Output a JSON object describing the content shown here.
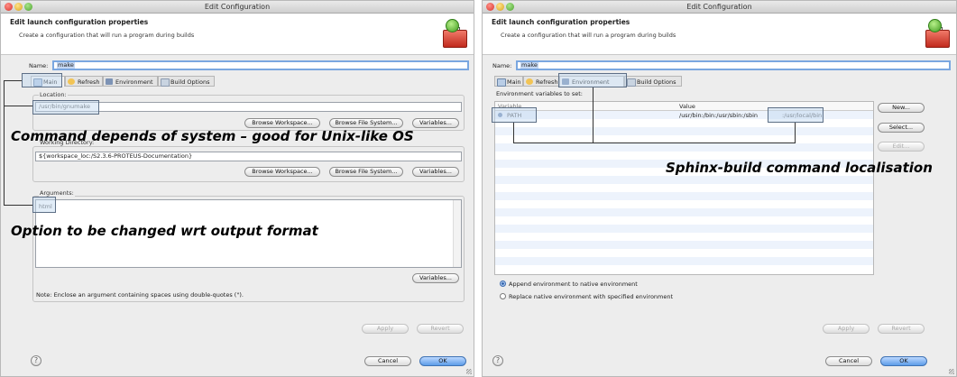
{
  "window_title": "Edit Configuration",
  "banner": {
    "heading": "Edit launch configuration properties",
    "subtitle": "Create a configuration that will run a program during builds"
  },
  "name_label": "Name:",
  "name_value": "make",
  "tabs": [
    {
      "label": "Main",
      "icon": "main-tab-icon"
    },
    {
      "label": "Refresh",
      "icon": "refresh-tab-icon"
    },
    {
      "label": "Environment",
      "icon": "environment-tab-icon"
    },
    {
      "label": "Build Options",
      "icon": "build-options-tab-icon"
    }
  ],
  "main_tab": {
    "location_label": "Location:",
    "location_value": "/usr/bin/gnumake",
    "workdir_label": "Working Directory:",
    "workdir_value": "${workspace_loc:/S2.3.6-PROTEUS-Documentation}",
    "arguments_label": "Arguments:",
    "arguments_value": "html",
    "browse_workspace": "Browse Workspace...",
    "browse_filesystem": "Browse File System...",
    "variables": "Variables...",
    "note": "Note: Enclose an argument containing spaces using double-quotes (\")."
  },
  "env_tab": {
    "section_label": "Environment variables to set:",
    "col_variable": "Variable",
    "col_value": "Value",
    "rows": [
      {
        "variable": "PATH",
        "value_prefix": "/usr/bin:/bin:/usr/sbin:/sbin",
        "value_suffix": ":/usr/local/bin"
      }
    ],
    "buttons": {
      "new": "New...",
      "select": "Select...",
      "edit": "Edit..."
    },
    "radio_append": "Append environment to native environment",
    "radio_replace": "Replace native environment with specified environment"
  },
  "footer": {
    "apply": "Apply",
    "revert": "Revert",
    "cancel": "Cancel",
    "ok": "OK",
    "help": "?"
  },
  "annotations": {
    "command": "Command depends of system – good for Unix-like OS",
    "option": "Option to be changed wrt output format",
    "sphinx": "Sphinx-build command localisation"
  }
}
